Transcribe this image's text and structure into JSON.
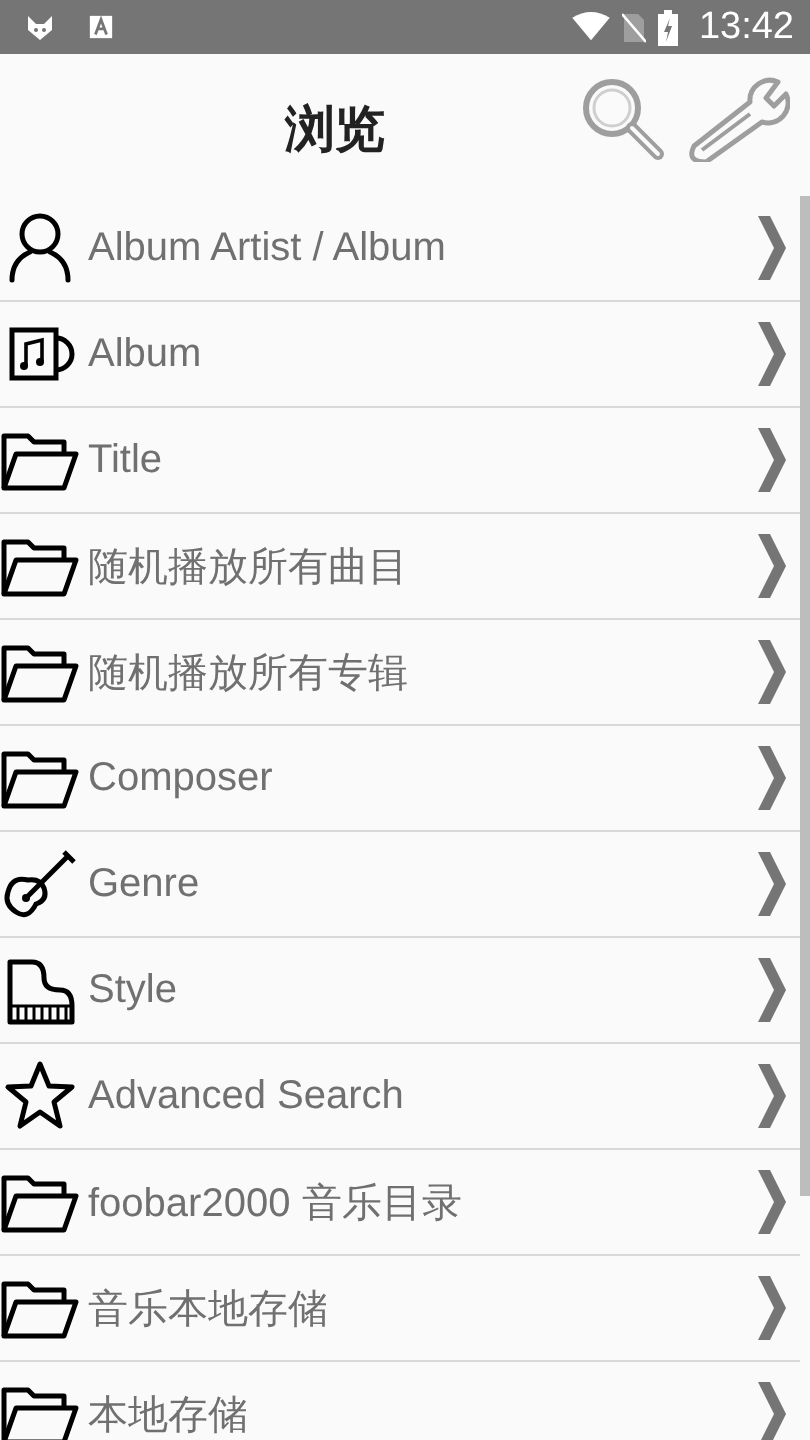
{
  "status_bar": {
    "time": "13:42"
  },
  "header": {
    "title": "浏览"
  },
  "items": [
    {
      "label": "Album Artist / Album",
      "kind": "person"
    },
    {
      "label": "Album",
      "kind": "album"
    },
    {
      "label": "Title",
      "kind": "folder"
    },
    {
      "label": "随机播放所有曲目",
      "kind": "folder"
    },
    {
      "label": "随机播放所有专辑",
      "kind": "folder"
    },
    {
      "label": "Composer",
      "kind": "folder"
    },
    {
      "label": "Genre",
      "kind": "guitar"
    },
    {
      "label": "Style",
      "kind": "piano"
    },
    {
      "label": "Advanced Search",
      "kind": "star"
    },
    {
      "label": "foobar2000 音乐目录",
      "kind": "folder"
    },
    {
      "label": "音乐本地存储",
      "kind": "folder"
    },
    {
      "label": "本地存储",
      "kind": "folder"
    }
  ]
}
